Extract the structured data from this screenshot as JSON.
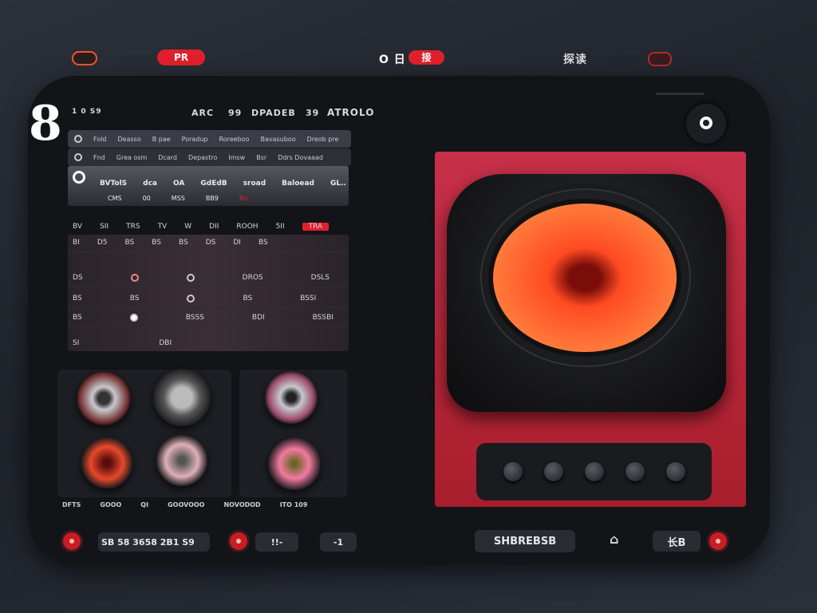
{
  "topbar": {
    "rec_label": "PR",
    "center_left": "O 日",
    "center_pill": "接",
    "right_label": "探读"
  },
  "header": {
    "logo": "8",
    "items": [
      "1 0 S9",
      "ARC",
      "99",
      "DPADEB",
      "39",
      "ATROLO"
    ]
  },
  "filter_rows": [
    [
      "Fold",
      "Deasso",
      "B pae",
      "Poradup",
      "Roreeboo",
      "Bavasuboo",
      "Dreob pre"
    ],
    [
      "Fnd",
      "Grea osm",
      "Dcard",
      "Depastro",
      "Imsw",
      "Bsr",
      "Ddrs Dovaaad"
    ]
  ],
  "selected_row": {
    "cells": [
      "BVTolS",
      "dca",
      "OA",
      "GdEdB",
      "sroad",
      "Baloead",
      "GL.."
    ],
    "sub": [
      "CMS",
      "00",
      "MSS",
      "BB9",
      "Bo"
    ]
  },
  "table": {
    "headers": [
      "BV",
      "SII",
      "TRS",
      "TV",
      "W",
      "DII",
      "ROOH",
      "5II",
      "TRA"
    ],
    "rows": [
      [
        "BI",
        "D5",
        "BS",
        "BS",
        "BS",
        "DS",
        "DI",
        "BS"
      ],
      [
        "DS",
        "DROS",
        "",
        "",
        "",
        "DSLS",
        "",
        ""
      ],
      [
        "BS",
        "BS",
        "",
        "",
        "",
        "BS",
        "BSSI",
        ""
      ],
      [
        "BS",
        "BSSS",
        "",
        "",
        "",
        "BDI",
        "BSSBI",
        ""
      ],
      [
        "SI",
        "",
        "",
        "",
        "",
        "",
        "DBI",
        ""
      ]
    ]
  },
  "speaker_captions": [
    "DFTS",
    "GOOO",
    "QI",
    "GOOVOOO",
    "NOVODOD",
    "ITO 109"
  ],
  "bottom": {
    "left_display": "SB 58 3658 2B1 S9",
    "mid_label": "!!-",
    "mid2_label": "-1",
    "center_display": "SHBREBSB",
    "arrow": "⌂",
    "right_label": "长B"
  },
  "colors": {
    "accent": "#e0202c",
    "panel": "#121418",
    "speaker_panel": "#b8243a",
    "cone": "#ff5a2a"
  }
}
